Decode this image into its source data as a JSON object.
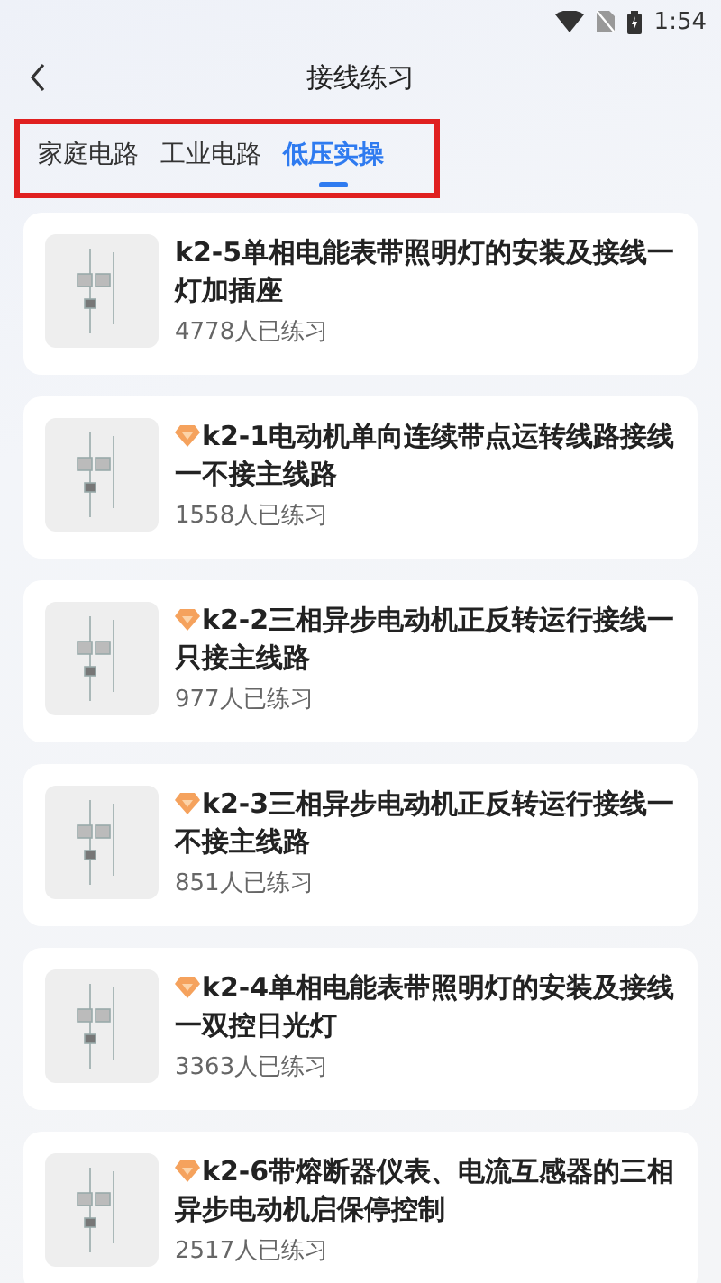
{
  "status_bar": {
    "time": "1:54"
  },
  "header": {
    "title": "接线练习"
  },
  "tabs_highlighted": true,
  "tabs": [
    {
      "label": "家庭电路",
      "selected": false
    },
    {
      "label": "工业电路",
      "selected": false
    },
    {
      "label": "低压实操",
      "selected": true
    }
  ],
  "items": [
    {
      "title": "k2-5单相电能表带照明灯的安装及接线一灯加插座",
      "count": "4778人已练习",
      "premium": false
    },
    {
      "title": "k2-1电动机单向连续带点运转线路接线一不接主线路",
      "count": "1558人已练习",
      "premium": true
    },
    {
      "title": "k2-2三相异步电动机正反转运行接线一只接主线路",
      "count": "977人已练习",
      "premium": true
    },
    {
      "title": "k2-3三相异步电动机正反转运行接线一不接主线路",
      "count": "851人已练习",
      "premium": true
    },
    {
      "title": "k2-4单相电能表带照明灯的安装及接线一双控日光灯",
      "count": "3363人已练习",
      "premium": true
    },
    {
      "title": "k2-6带熔断器仪表、电流互感器的三相异步电动机启保停控制",
      "count": "2517人已练习",
      "premium": true
    }
  ]
}
